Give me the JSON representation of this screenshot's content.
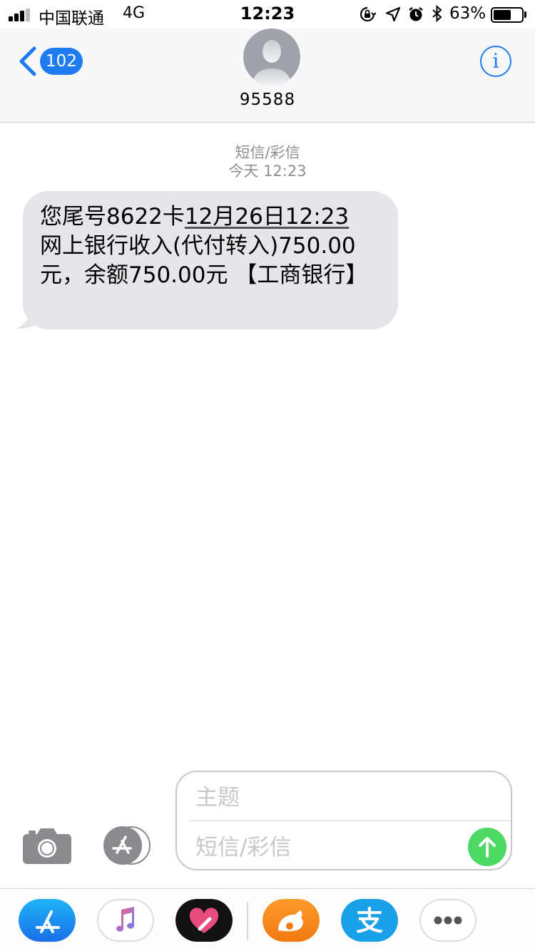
{
  "status_bar": {
    "carrier": "中国联通",
    "network": "4G",
    "time": "12:23",
    "battery_percent": "63%",
    "battery_level": 0.63,
    "icons": [
      "rotation-lock-icon",
      "location-arrow-icon",
      "alarm-icon",
      "bluetooth-icon"
    ]
  },
  "header": {
    "back_count": "102",
    "contact": "95588",
    "info_glyph": "i"
  },
  "conversation": {
    "type_label": "短信/彩信",
    "timestamp": "今天 12:23",
    "message": {
      "part1": "您尾号8622卡",
      "date_link": "12月26日12:23",
      "part2": "网上银行收入(代付转入)750.00元，余额750.00元 【工商银行】"
    }
  },
  "compose": {
    "subject_placeholder": "主题",
    "message_placeholder": "短信/彩信"
  },
  "app_drawer": {
    "apps": [
      "app-store-icon",
      "music-icon",
      "heart-app-icon",
      "uc-browser-icon",
      "alipay-icon",
      "more-icon"
    ],
    "alipay_glyph": "支"
  },
  "colors": {
    "accent": "#1e7cf0",
    "bubble": "#e5e5ea",
    "send": "#4cd964",
    "meta": "#8e8e93"
  }
}
